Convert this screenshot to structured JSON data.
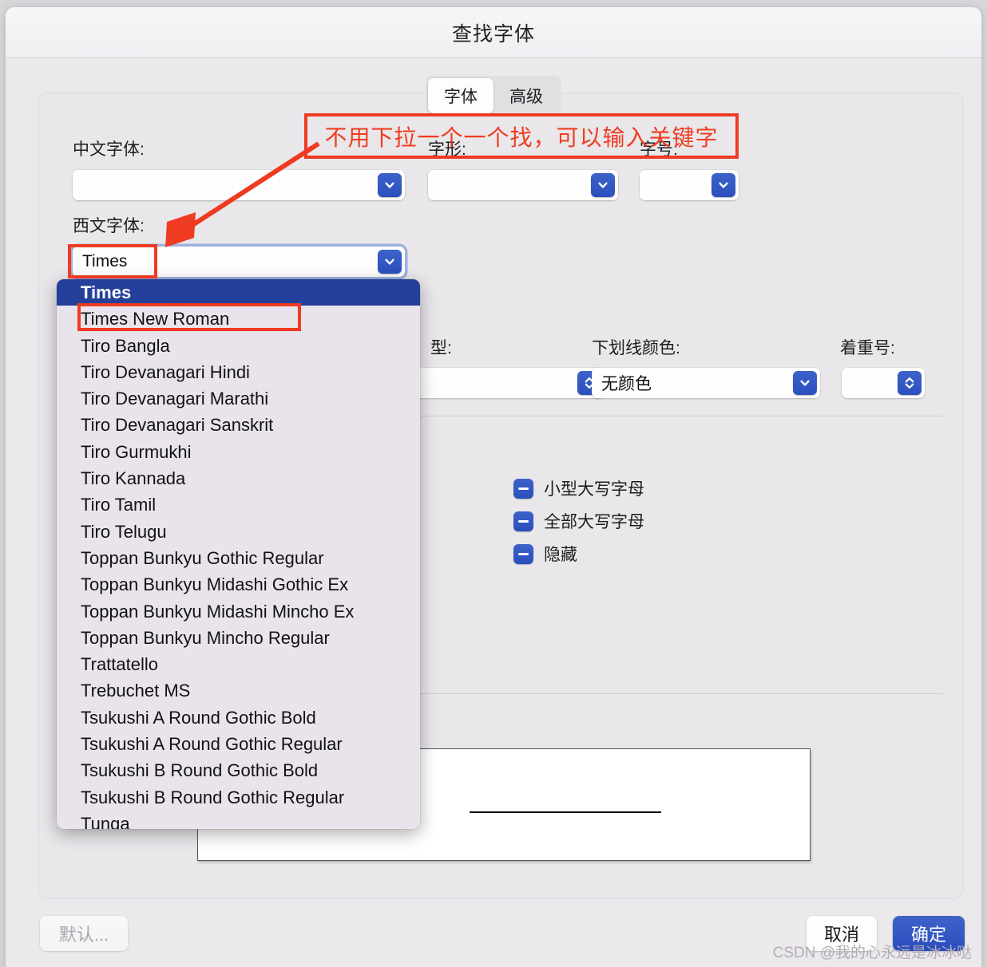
{
  "window": {
    "title": "查找字体"
  },
  "tabs": [
    {
      "label": "字体",
      "active": true
    },
    {
      "label": "高级",
      "active": false
    }
  ],
  "fields": {
    "chinese_font": {
      "label": "中文字体:",
      "value": ""
    },
    "western_font": {
      "label": "西文字体:",
      "value": "Times"
    },
    "style": {
      "label": "字形:",
      "value": ""
    },
    "size": {
      "label": "字号:",
      "value": ""
    },
    "underline_type": {
      "label": "型:",
      "value": ""
    },
    "underline_color": {
      "label": "下划线颜色:",
      "value": "无颜色"
    },
    "emphasis_mark": {
      "label": "着重号:",
      "value": ""
    }
  },
  "checkboxes": [
    {
      "label": "小型大写字母",
      "state": "mixed"
    },
    {
      "label": "全部大写字母",
      "state": "mixed"
    },
    {
      "label": "隐藏",
      "state": "mixed"
    }
  ],
  "preview": {
    "sample_text": "^$"
  },
  "buttons": {
    "default": "默认...",
    "cancel": "取消",
    "ok": "确定"
  },
  "dropdown": {
    "selected": "Times",
    "options": [
      "Times",
      "Times New Roman",
      "Tiro Bangla",
      "Tiro Devanagari Hindi",
      "Tiro Devanagari Marathi",
      "Tiro Devanagari Sanskrit",
      "Tiro Gurmukhi",
      "Tiro Kannada",
      "Tiro Tamil",
      "Tiro Telugu",
      "Toppan Bunkyu Gothic Regular",
      "Toppan Bunkyu Midashi Gothic Ex",
      "Toppan Bunkyu Midashi Mincho Ex",
      "Toppan Bunkyu Mincho Regular",
      "Trattatello",
      "Trebuchet MS",
      "Tsukushi A Round Gothic Bold",
      "Tsukushi A Round Gothic Regular",
      "Tsukushi B Round Gothic Bold",
      "Tsukushi B Round Gothic Regular",
      "Tunga"
    ]
  },
  "annotations": {
    "note": "不用下拉一个一个找，可以输入关键字",
    "color": "#ee3b21"
  },
  "watermark": {
    "text": "CSDN @我的心永远是冰冰哒"
  }
}
